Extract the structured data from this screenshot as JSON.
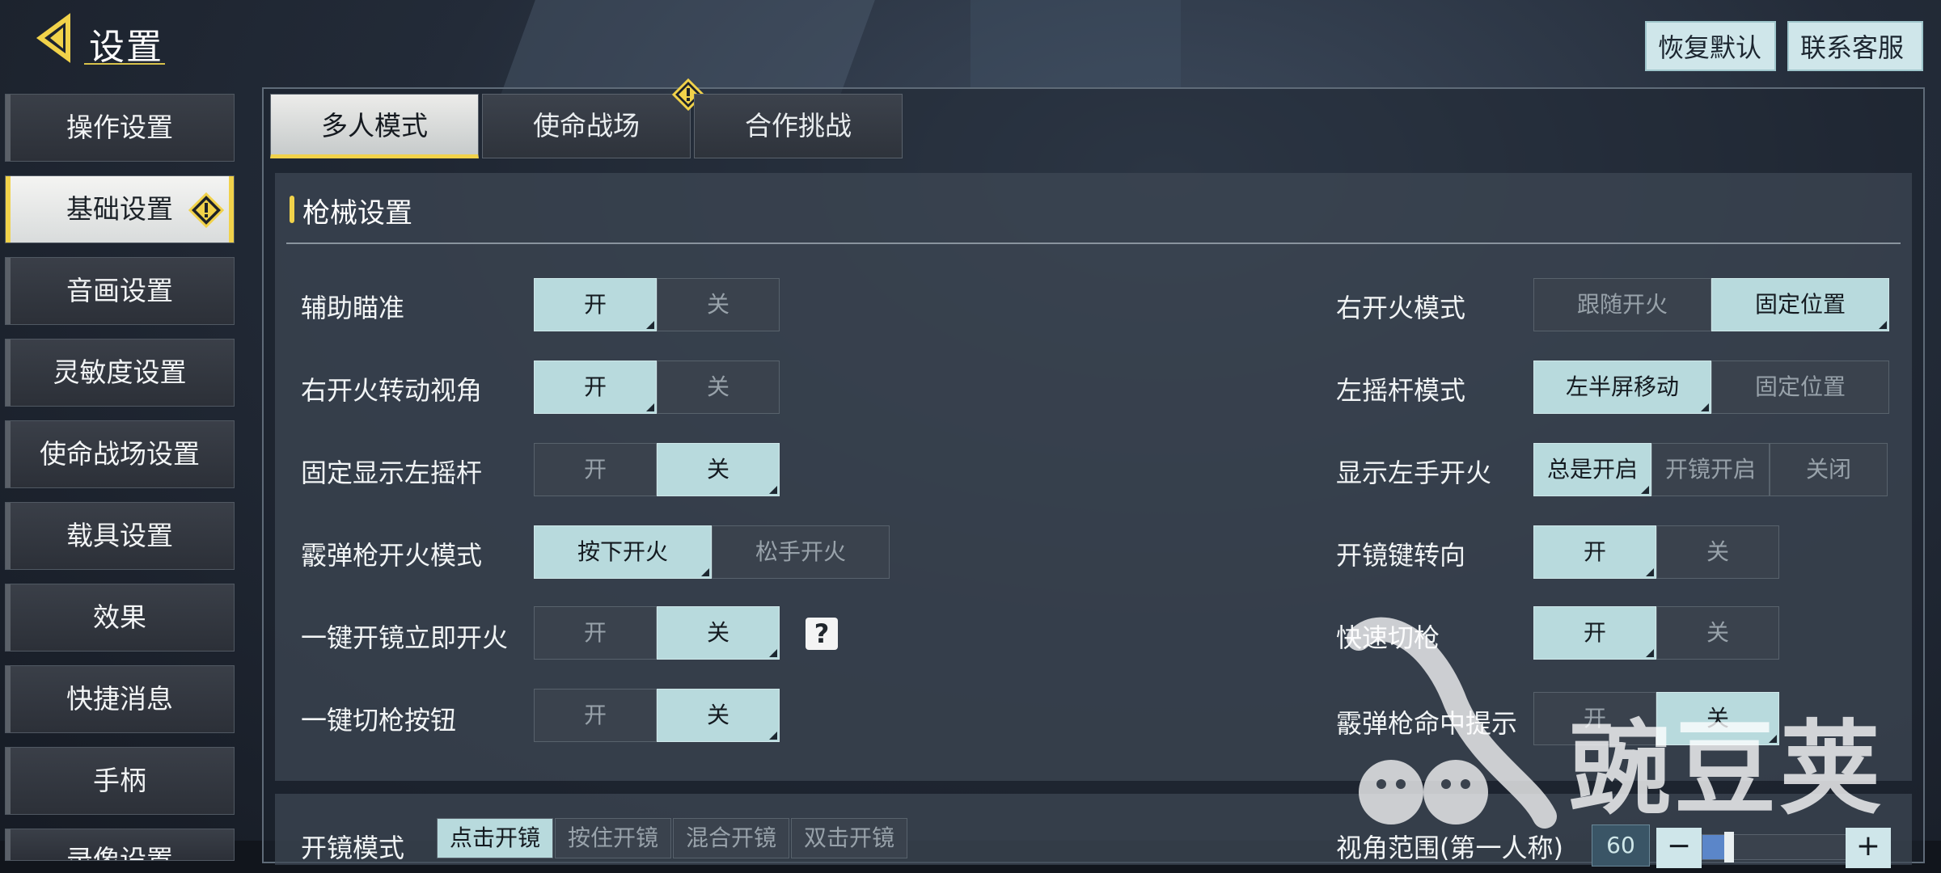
{
  "header": {
    "title": "设置",
    "restore_label": "恢复默认",
    "contact_label": "联系客服"
  },
  "sidebar": {
    "items": [
      {
        "label": "操作设置"
      },
      {
        "label": "基础设置",
        "active": true,
        "warning": true
      },
      {
        "label": "音画设置"
      },
      {
        "label": "灵敏度设置"
      },
      {
        "label": "使命战场设置"
      },
      {
        "label": "载具设置"
      },
      {
        "label": "效果"
      },
      {
        "label": "快捷消息"
      },
      {
        "label": "手柄"
      },
      {
        "label": "录像设置"
      }
    ]
  },
  "tabs": [
    {
      "label": "多人模式",
      "active": true
    },
    {
      "label": "使命战场",
      "warning": true
    },
    {
      "label": "合作挑战"
    }
  ],
  "section": {
    "title": "枪械设置"
  },
  "left_settings": [
    {
      "label": "辅助瞄准",
      "options": [
        "开",
        "关"
      ],
      "selected": "开"
    },
    {
      "label": "右开火转动视角",
      "options": [
        "开",
        "关"
      ],
      "selected": "开"
    },
    {
      "label": "固定显示左摇杆",
      "options": [
        "开",
        "关"
      ],
      "selected": "关"
    },
    {
      "label": "霰弹枪开火模式",
      "options": [
        "按下开火",
        "松手开火"
      ],
      "selected": "按下开火"
    },
    {
      "label": "一键开镜立即开火",
      "options": [
        "开",
        "关"
      ],
      "selected": "关",
      "help": "?"
    },
    {
      "label": "一键切枪按钮",
      "options": [
        "开",
        "关"
      ],
      "selected": "关"
    }
  ],
  "right_settings": [
    {
      "label": "右开火模式",
      "options": [
        "跟随开火",
        "固定位置"
      ],
      "selected": "固定位置"
    },
    {
      "label": "左摇杆模式",
      "options": [
        "左半屏移动",
        "固定位置"
      ],
      "selected": "左半屏移动"
    },
    {
      "label": "显示左手开火",
      "options": [
        "总是开启",
        "开镜开启",
        "关闭"
      ],
      "selected": "总是开启"
    },
    {
      "label": "开镜键转向",
      "options": [
        "开",
        "关"
      ],
      "selected": "开"
    },
    {
      "label": "快速切枪",
      "options": [
        "开",
        "关"
      ],
      "selected": "开"
    },
    {
      "label": "霰弹枪命中提示",
      "options": [
        "开",
        "关"
      ],
      "selected": "关"
    }
  ],
  "scope_mode": {
    "label": "开镜模式",
    "options": [
      "点击开镜",
      "按住开镜",
      "混合开镜",
      "双击开镜"
    ],
    "selected": "点击开镜"
  },
  "fov": {
    "label": "视角范围(第一人称)",
    "value": "60",
    "minus": "−",
    "plus": "+",
    "level_fraction": 0.15
  },
  "watermark": {
    "text": "豌豆荚"
  },
  "colors": {
    "accent": "#f1d24a",
    "selected": "#b8dadd"
  }
}
